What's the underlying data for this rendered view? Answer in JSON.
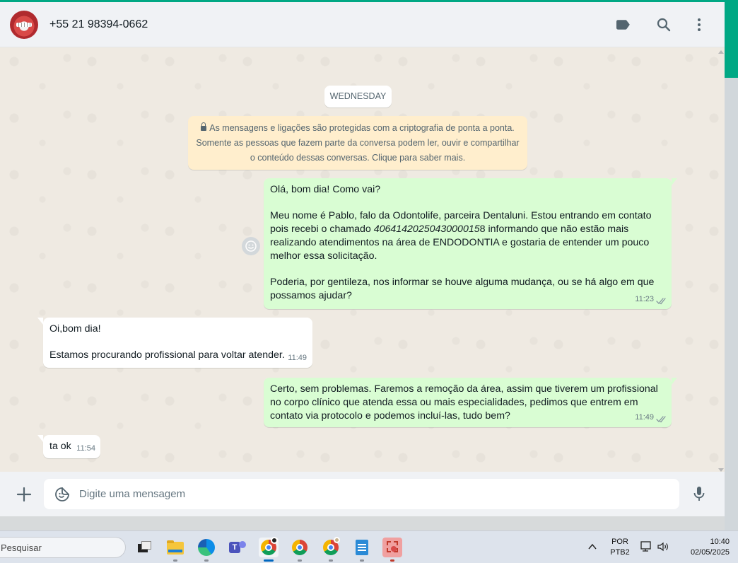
{
  "header": {
    "contact_name": "+55 21 98394-0662",
    "icons": [
      "label-icon",
      "search-icon",
      "menu-icon"
    ]
  },
  "chat": {
    "day_label": "WEDNESDAY",
    "encryption_notice": {
      "line1": "As mensagens e ligações são protegidas com a criptografia de ponta a ponta.",
      "line2": "Somente as pessoas que fazem parte da conversa podem ler, ouvir e compartilhar",
      "line3": "o conteúdo dessas conversas. Clique para saber mais."
    },
    "messages": [
      {
        "direction": "outgoing",
        "p1": "Olá, bom dia! Como vai?",
        "p2a": "Meu nome é Pablo, falo da Odontolife, parceira Dentaluni. Estou entrando em contato pois recebi o chamado ",
        "p2b": "4064142025043000015",
        "p2c": "8 informando que não estão mais realizando atendimentos na área de ENDODONTIA e gostaria de entender um pouco melhor essa solicitação.",
        "p3": "Poderia, por gentileza, nos informar se houve alguma mudança, ou se há algo em que possamos ajudar?",
        "time": "11:23",
        "status": "read"
      },
      {
        "direction": "incoming",
        "p1": "Oi,bom dia!",
        "p2": "Estamos procurando profissional para voltar atender.",
        "time": "11:49"
      },
      {
        "direction": "outgoing",
        "p1": "Certo, sem problemas. Faremos a remoção da área, assim que tiverem um profissional no corpo clínico que atenda essa ou mais especialidades, pedimos que entrem em contato via protocolo e podemos incluí-las, tudo bem?",
        "time": "11:49",
        "status": "read"
      },
      {
        "direction": "incoming",
        "p1": "ta ok",
        "time": "11:54"
      }
    ]
  },
  "composer": {
    "placeholder": "Digite uma mensagem"
  },
  "taskbar": {
    "search_placeholder": "Pesquisar",
    "language": "POR",
    "keyboard": "PTB2",
    "time": "10:40",
    "date": "02/05/2025"
  },
  "colors": {
    "accent": "#00a884",
    "outgoing_bubble": "#d9fdd3",
    "incoming_bubble": "#ffffff",
    "chat_bg": "#efeae2",
    "read_ticks": "#8696a0"
  }
}
